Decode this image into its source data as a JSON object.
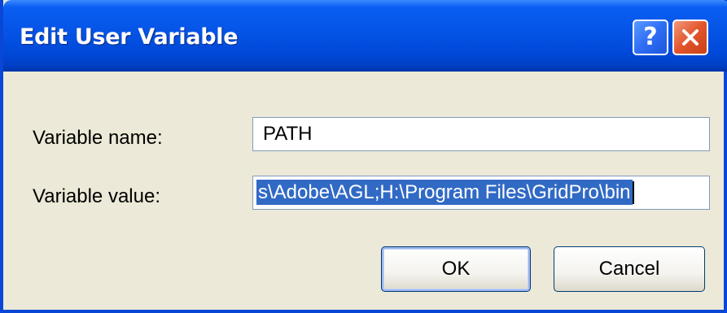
{
  "window": {
    "title": "Edit User Variable",
    "title_buttons": [
      {
        "name": "help",
        "icon": "question-mark-icon",
        "glyph": "?"
      },
      {
        "name": "close",
        "icon": "close-icon"
      }
    ]
  },
  "form": {
    "variable_name_label": "Variable name:",
    "variable_name_value": "PATH",
    "variable_value_label": "Variable value:",
    "variable_value_value": "s\\Adobe\\AGL;H:\\Program Files\\GridPro\\bin",
    "variable_value_selected": true
  },
  "buttons": {
    "ok_label": "OK",
    "cancel_label": "Cancel"
  },
  "colors": {
    "titlebar": "#0554e6",
    "dialog_background": "#ece9d8",
    "selection": "#316ac5",
    "close_button": "#e2552c"
  }
}
